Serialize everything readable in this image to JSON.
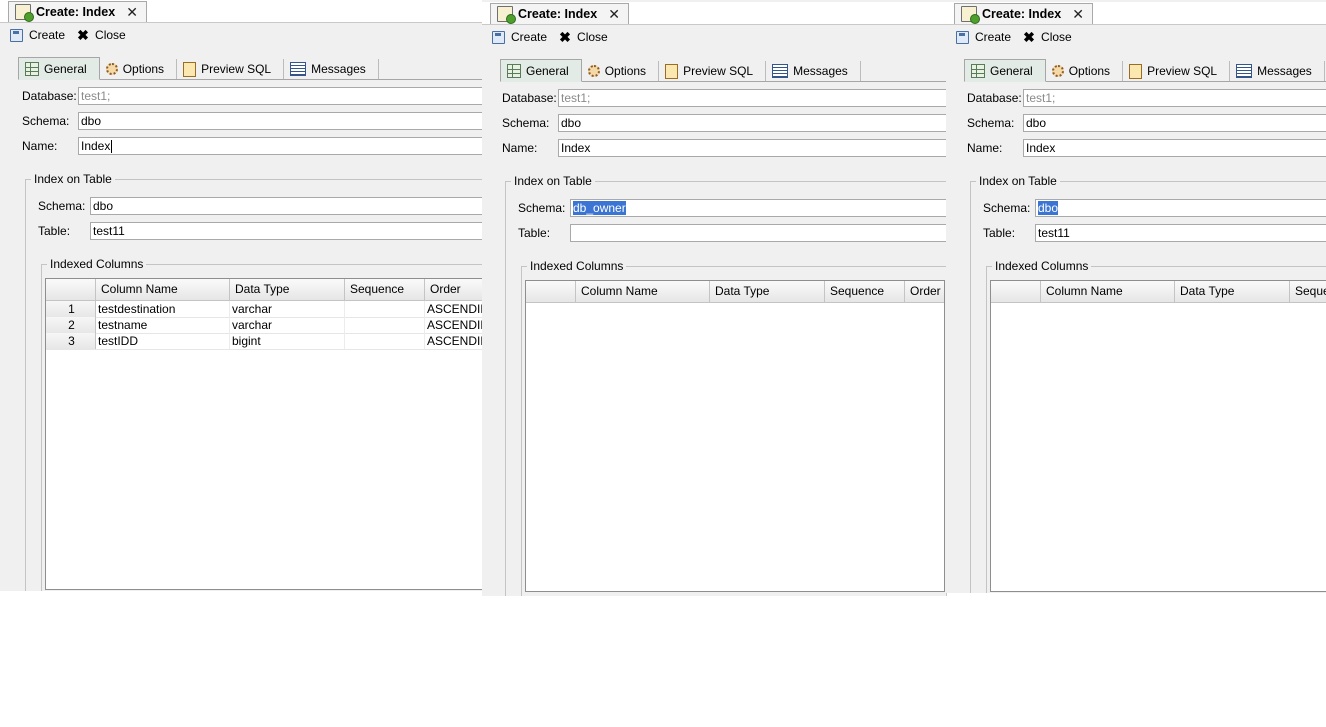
{
  "panels": [
    {
      "tab_title": "Create: Index",
      "toolbar": {
        "create_label": "Create",
        "close_label": "Close"
      },
      "subtabs": [
        "General",
        "Options",
        "Preview SQL",
        "Messages"
      ],
      "database": {
        "label": "Database:",
        "value": "test1;"
      },
      "schema": {
        "label": "Schema:",
        "value": "dbo"
      },
      "name": {
        "label": "Name:",
        "value": "Index"
      },
      "index_on_table": {
        "title": "Index on Table",
        "schema_label": "Schema:",
        "schema_value": "dbo",
        "table_label": "Table:",
        "table_value": "test11"
      },
      "indexed_columns": {
        "title": "Indexed Columns",
        "headers": [
          "",
          "Column Name",
          "Data Type",
          "Sequence",
          "Order"
        ],
        "rows": [
          [
            "1",
            "testdestination",
            "varchar",
            "",
            "ASCENDING"
          ],
          [
            "2",
            "testname",
            "varchar",
            "",
            "ASCENDING"
          ],
          [
            "3",
            "testIDD",
            "bigint",
            "",
            "ASCENDING"
          ]
        ]
      }
    },
    {
      "tab_title": "Create: Index",
      "toolbar": {
        "create_label": "Create",
        "close_label": "Close"
      },
      "subtabs": [
        "General",
        "Options",
        "Preview SQL",
        "Messages"
      ],
      "database": {
        "label": "Database:",
        "value": "test1;"
      },
      "schema": {
        "label": "Schema:",
        "value": "dbo"
      },
      "name": {
        "label": "Name:",
        "value": "Index"
      },
      "index_on_table": {
        "title": "Index on Table",
        "schema_label": "Schema:",
        "schema_value": "db_owner",
        "table_label": "Table:",
        "table_value": ""
      },
      "indexed_columns": {
        "title": "Indexed Columns",
        "headers": [
          "",
          "Column Name",
          "Data Type",
          "Sequence",
          "Order"
        ],
        "rows": []
      }
    },
    {
      "tab_title": "Create: Index",
      "toolbar": {
        "create_label": "Create",
        "close_label": "Close"
      },
      "subtabs": [
        "General",
        "Options",
        "Preview SQL",
        "Messages"
      ],
      "database": {
        "label": "Database:",
        "value": "test1;"
      },
      "schema": {
        "label": "Schema:",
        "value": "dbo"
      },
      "name": {
        "label": "Name:",
        "value": "Index"
      },
      "index_on_table": {
        "title": "Index on Table",
        "schema_label": "Schema:",
        "schema_value": "dbo",
        "table_label": "Table:",
        "table_value": "test11"
      },
      "indexed_columns": {
        "title": "Indexed Columns",
        "headers": [
          "",
          "Column Name",
          "Data Type",
          "Sequence"
        ],
        "rows": []
      }
    }
  ]
}
